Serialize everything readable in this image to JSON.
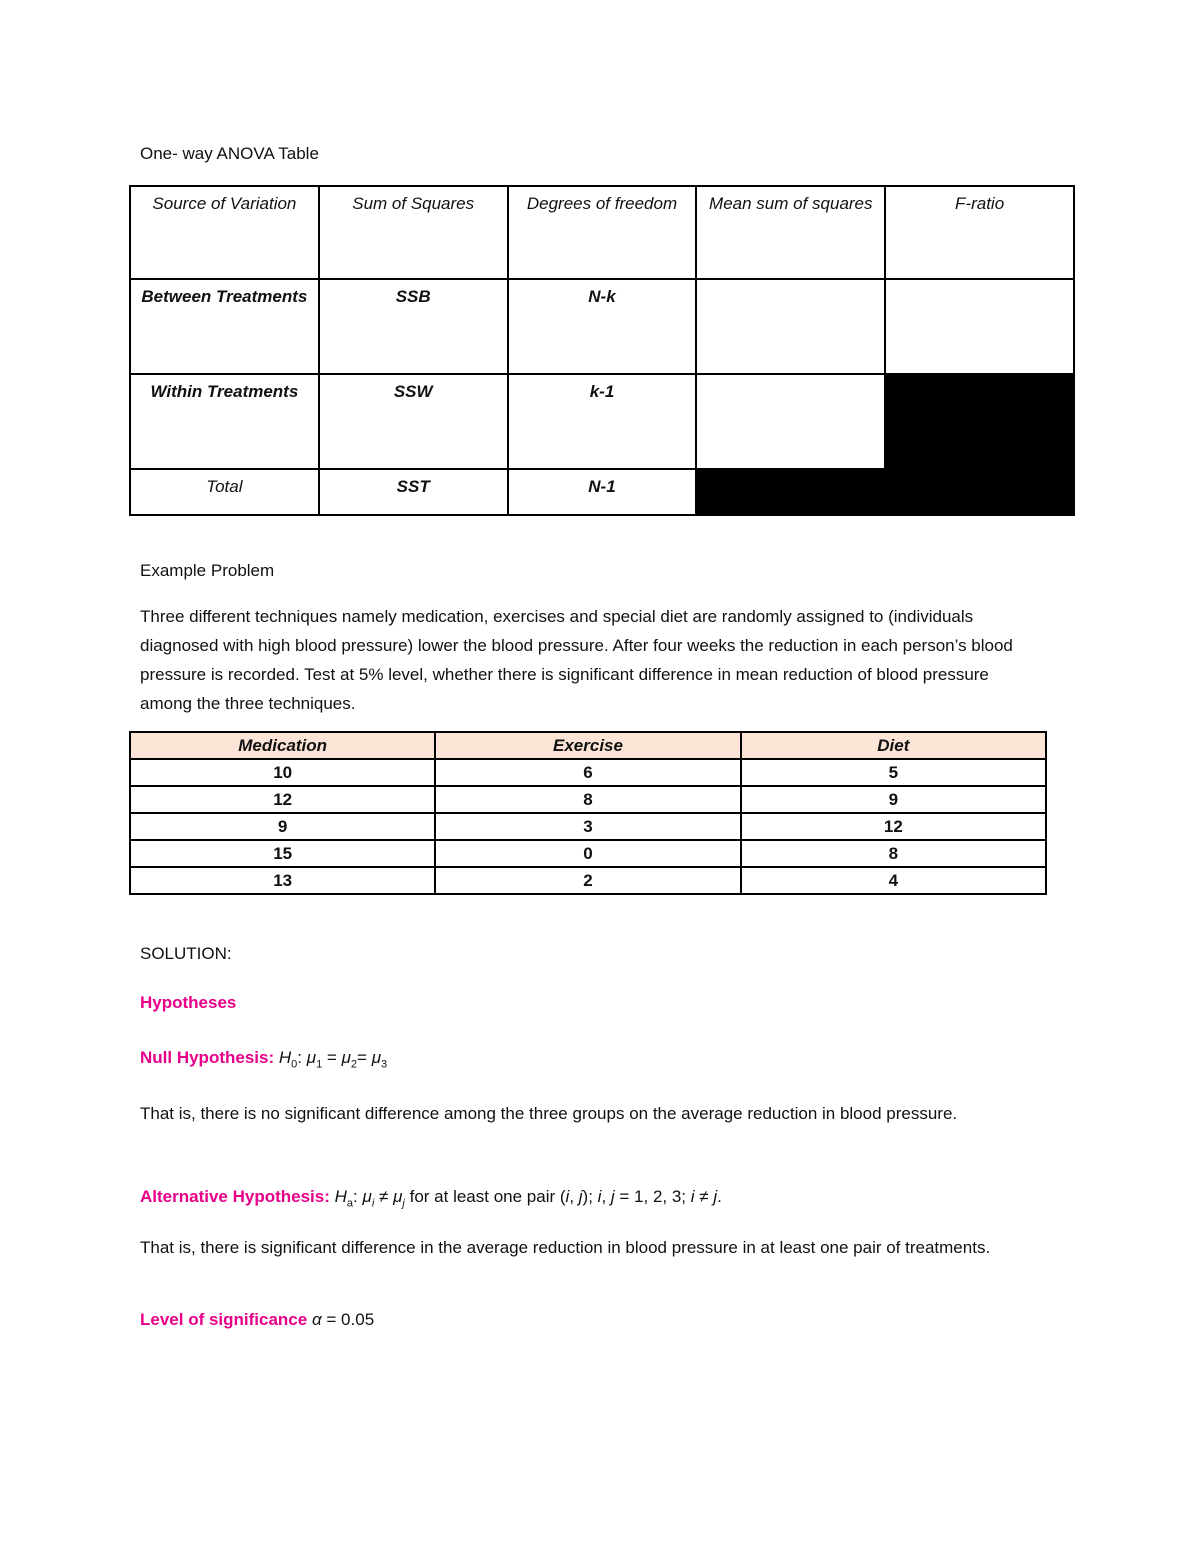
{
  "document": {
    "anova_title": "One- way ANOVA Table",
    "anova_table": {
      "headers": [
        "Source of Variation",
        "Sum of Squares",
        "Degrees of freedom",
        "Mean sum of squares",
        "F-ratio"
      ],
      "rows": [
        {
          "source": "Between Treatments",
          "ss": "SSB",
          "df": "N-k",
          "ms": "",
          "f": ""
        },
        {
          "source": "Within Treatments",
          "ss": "SSW",
          "df": "k-1",
          "ms": "",
          "f": null
        },
        {
          "source": "Total",
          "ss": "SST",
          "df": "N-1",
          "ms": null,
          "f": null
        }
      ]
    },
    "example_heading": "Example Problem",
    "problem_text": "Three different techniques namely medication, exercises and special diet are randomly assigned to (individuals diagnosed with high blood pressure) lower the blood pressure. After four weeks the reduction in each person’s blood pressure is recorded. Test at 5% level, whether there is significant difference in mean reduction of blood pressure among the three techniques.",
    "data_table": {
      "headers": [
        "Medication",
        "Exercise",
        "Diet"
      ],
      "rows": [
        [
          "10",
          "6",
          "5"
        ],
        [
          "12",
          "8",
          "9"
        ],
        [
          "9",
          "3",
          "12"
        ],
        [
          "15",
          "0",
          "8"
        ],
        [
          "13",
          "2",
          "4"
        ]
      ],
      "header_fill": "#fce4d6"
    },
    "solution_label": "SOLUTION:",
    "hypotheses_heading": "Hypotheses",
    "null_label": "Null Hypothesis:",
    "null_expr": {
      "h": "H",
      "h_sub": "0",
      "sep": ":",
      "mu": "μ",
      "parts": [
        "1",
        "2",
        "3"
      ],
      "eq": "="
    },
    "null_explanation": "That is, there is no significant difference among the three groups on the average reduction in blood pressure.",
    "alt_label": "Alternative Hypothesis:",
    "alt_expr": {
      "h": "H",
      "h_sub": "a",
      "sep": ":",
      "mu": "μ",
      "i": "i",
      "j": "j",
      "neq": "≠",
      "text1": "for at least one pair (",
      "text2": "); ",
      "text3": " = 1, 2, 3; ",
      "end": "."
    },
    "alt_explanation": "That is, there is significant difference in the average reduction in blood pressure in at least one pair of treatments.",
    "significance_label": "Level of significance",
    "alpha_symbol": "α",
    "alpha_value": "= 0.05",
    "accent_color": "#e8008a"
  }
}
